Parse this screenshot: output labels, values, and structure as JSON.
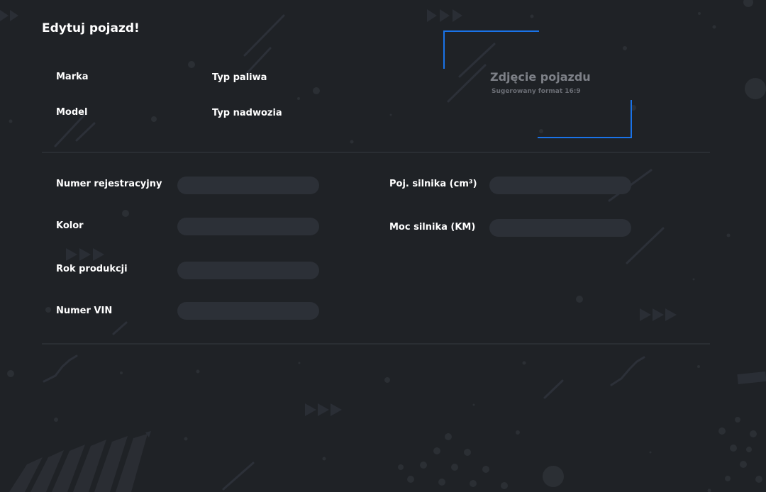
{
  "form": {
    "title": "Edytuj pojazd!",
    "labels": {
      "brand": "Marka",
      "model": "Model",
      "fuel_type": "Typ paliwa",
      "body_type": "Typ nadwozia",
      "registration_number": "Numer rejestracyjny",
      "color": "Kolor",
      "production_year": "Rok produkcji",
      "vin": "Numer VIN",
      "engine_capacity": "Poj. silnika (cm³)",
      "engine_power": "Moc silnika (KM)"
    },
    "values": {
      "registration_number": "",
      "color": "",
      "production_year": "",
      "vin": "",
      "engine_capacity": "",
      "engine_power": ""
    }
  },
  "photo": {
    "title": "Zdjęcie pojazdu",
    "hint": "Sugerowany format 16:9"
  },
  "colors": {
    "background": "#1f2226",
    "field": "#2c3037",
    "accent": "#1a73e8",
    "decor": "#2c3038"
  }
}
